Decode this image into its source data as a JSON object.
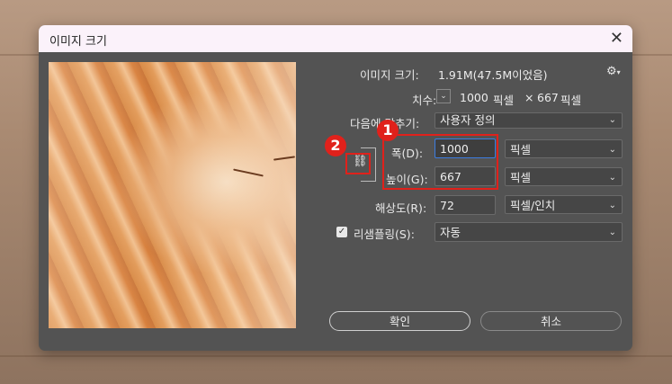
{
  "dialog": {
    "title": "이미지 크기",
    "close_glyph": "✕"
  },
  "info": {
    "image_size_label": "이미지 크기:",
    "image_size_value": "1.91M(47.5M이었음)",
    "dimensions_label": "치수:",
    "dimensions_width": "1000",
    "dimensions_width_unit": "픽셀",
    "dimensions_sep": "×",
    "dimensions_height": "667",
    "dimensions_height_unit": "픽셀"
  },
  "fit_to": {
    "label": "다음에 맞추기:",
    "value": "사용자 정의"
  },
  "width": {
    "label": "폭(D):",
    "value": "1000",
    "unit": "픽셀"
  },
  "height": {
    "label": "높이(G):",
    "value": "667",
    "unit": "픽셀"
  },
  "resolution": {
    "label": "해상도(R):",
    "value": "72",
    "unit": "픽셀/인치"
  },
  "resample": {
    "label": "리샘플링(S):",
    "value": "자동",
    "checked": true
  },
  "buttons": {
    "ok": "확인",
    "cancel": "취소"
  },
  "annotations": {
    "marker1": "1",
    "marker2": "2",
    "marker_color": "#e0211b"
  },
  "icons": {
    "settings": "gear-icon",
    "link": "chain-link-icon",
    "dropdown": "chevron-down-icon"
  }
}
